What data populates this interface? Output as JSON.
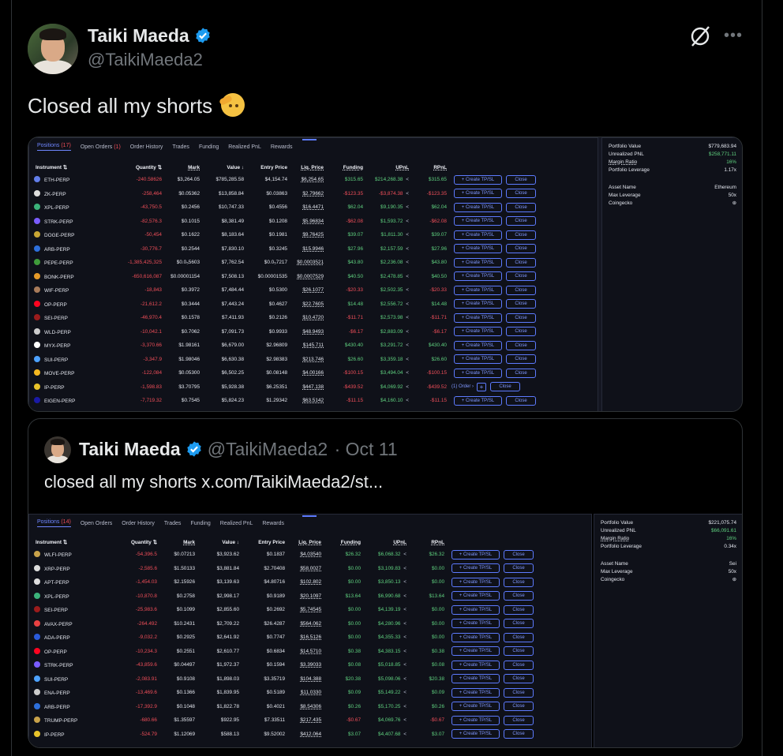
{
  "author": {
    "name": "Taiki Maeda",
    "handle": "@TaikiMaeda2"
  },
  "tweet": {
    "text": "Closed all my shorts"
  },
  "quoted": {
    "name": "Taiki Maeda",
    "handle": "@TaikiMaeda2",
    "date": "· Oct 11",
    "text": "closed all my shorts  x.com/TaikiMaeda2/st..."
  },
  "colors": {
    "accent": "#1d9bf0",
    "profit": "#5fd17f",
    "loss": "#ef4e59",
    "link": "#7f97ff"
  },
  "shot1": {
    "tabs": [
      {
        "label": "Positions",
        "badge": "(17)"
      },
      {
        "label": "Open Orders",
        "badge": "(1)"
      },
      {
        "label": "Order History",
        "badge": ""
      },
      {
        "label": "Trades",
        "badge": ""
      },
      {
        "label": "Funding",
        "badge": ""
      },
      {
        "label": "Realized PnL",
        "badge": ""
      },
      {
        "label": "Rewards",
        "badge": ""
      }
    ],
    "headers": [
      "Instrument",
      "Quantity",
      "Mark",
      "Value",
      "Entry Price",
      "Liq. Price",
      "Funding",
      "UPnL",
      "RPnL"
    ],
    "rows": [
      [
        "ETH-PERP",
        "-240.58626",
        "$3,264.05",
        "$785,285.58",
        "$4,154.74",
        "$6,254.65",
        "$315.65",
        "$214,268.38",
        "$315.65",
        "#627eea"
      ],
      [
        "ZK-PERP",
        "-258,464",
        "$0.05362",
        "$13,858.84",
        "$0.03863",
        "$2.79662",
        "-$123.35",
        "-$3,874.38",
        "-$123.35",
        "#dddddd"
      ],
      [
        "XPL-PERP",
        "-43,750.5",
        "$0.2456",
        "$10,747.33",
        "$0.4556",
        "$16.4471",
        "$62.04",
        "$9,190.35",
        "$62.04",
        "#3bb27a"
      ],
      [
        "STRK-PERP",
        "-82,576.3",
        "$0.1015",
        "$8,381.49",
        "$0.1208",
        "$5.96834",
        "-$62.08",
        "$1,593.72",
        "-$62.08",
        "#7a5cff"
      ],
      [
        "DOGE-PERP",
        "-50,454",
        "$0.1622",
        "$8,183.64",
        "$0.1981",
        "$9.76425",
        "$39.07",
        "$1,811.30",
        "$39.07",
        "#c8a634"
      ],
      [
        "ARB-PERP",
        "-30,776.7",
        "$0.2544",
        "$7,830.10",
        "$0.3245",
        "$15.9946",
        "$27.96",
        "$2,157.59",
        "$27.96",
        "#2d6fdb"
      ],
      [
        "PEPE-PERP",
        "-1,385,425,325",
        "$0.0₅5603",
        "$7,762.54",
        "$0.0₅7217",
        "$0.0003521",
        "$43.80",
        "$2,236.08",
        "$43.80",
        "#3f9b3a"
      ],
      [
        "BONK-PERP",
        "-650,616,087",
        "$0.00001154",
        "$7,508.13",
        "$0.00001535",
        "$0.0007529",
        "$40.50",
        "$2,478.85",
        "$40.50",
        "#e69a28"
      ],
      [
        "WIF-PERP",
        "-18,843",
        "$0.3972",
        "$7,484.44",
        "$0.5300",
        "$26.1077",
        "-$20.33",
        "$2,502.35",
        "-$20.33",
        "#a87b5a"
      ],
      [
        "OP-PERP",
        "-21,612.2",
        "$0.3444",
        "$7,443.24",
        "$0.4627",
        "$22.7605",
        "$14.48",
        "$2,556.72",
        "$14.48",
        "#ff0420"
      ],
      [
        "SEI-PERP",
        "-46,970.4",
        "$0.1578",
        "$7,411.93",
        "$0.2126",
        "$10.4720",
        "-$11.71",
        "$2,573.98",
        "-$11.71",
        "#9b1c1c"
      ],
      [
        "WLD-PERP",
        "-10,042.1",
        "$0.7062",
        "$7,091.73",
        "$0.9933",
        "$48.9493",
        "-$6.17",
        "$2,883.09",
        "-$6.17",
        "#cccccc"
      ],
      [
        "MYX-PERP",
        "-3,370.66",
        "$1.98161",
        "$6,679.00",
        "$2.96809",
        "$145.711",
        "$430.40",
        "$3,291.72",
        "$430.40",
        "#ffffff"
      ],
      [
        "SUI-PERP",
        "-3,347.9",
        "$1.98046",
        "$6,630.38",
        "$2.98383",
        "$213.746",
        "$26.60",
        "$3,359.18",
        "$26.60",
        "#4da2ff"
      ],
      [
        "MOVE-PERP",
        "-122,084",
        "$0.05300",
        "$6,502.25",
        "$0.08148",
        "$4.00166",
        "-$100.15",
        "$3,494.04",
        "-$100.15",
        "#f5b820"
      ],
      [
        "IP-PERP",
        "-1,598.83",
        "$3.70795",
        "$5,928.38",
        "$6.25351",
        "$447.138",
        "-$439.52",
        "$4,069.92",
        "-$439.52",
        "#e8c32a"
      ],
      [
        "EIGEN-PERP",
        "-7,719.32",
        "$0.7545",
        "$5,824.23",
        "$1.29342",
        "$63.5142",
        "-$11.15",
        "$4,160.10",
        "-$11.15",
        "#1a1aa6"
      ]
    ],
    "ip_orders": "(1) Order ›",
    "create_label": "+ Create TP/SL",
    "close_label": "Close",
    "summary": [
      [
        "Portfolio Value",
        "$779,683.94"
      ],
      [
        "Unrealized PNL",
        "$258,771.11"
      ],
      [
        "Margin Ratio",
        "16%"
      ],
      [
        "Portfolio Leverage",
        "1.17x"
      ]
    ],
    "asset": [
      [
        "Asset Name",
        "Ethereum"
      ],
      [
        "Max Leverage",
        "50x"
      ],
      [
        "Coingecko",
        "⊛"
      ]
    ]
  },
  "shot2": {
    "tabs": [
      {
        "label": "Positions",
        "badge": "(14)"
      },
      {
        "label": "Open Orders",
        "badge": ""
      },
      {
        "label": "Order History",
        "badge": ""
      },
      {
        "label": "Trades",
        "badge": ""
      },
      {
        "label": "Funding",
        "badge": ""
      },
      {
        "label": "Realized PnL",
        "badge": ""
      },
      {
        "label": "Rewards",
        "badge": ""
      }
    ],
    "headers": [
      "Instrument",
      "Quantity",
      "Mark",
      "Value",
      "Entry Price",
      "Liq. Price",
      "Funding",
      "UPnL",
      "RPnL"
    ],
    "rows": [
      [
        "WLFI-PERP",
        "-54,396.5",
        "$0.07213",
        "$3,923.62",
        "$0.1837",
        "$4.03540",
        "$26.32",
        "$6,068.32",
        "$26.32",
        "#c8a24a"
      ],
      [
        "XRP-PERP",
        "-2,585.6",
        "$1.50133",
        "$3,881.84",
        "$2.70408",
        "$58.0027",
        "$0.00",
        "$3,109.83",
        "$0.00",
        "#dddddd"
      ],
      [
        "APT-PERP",
        "-1,454.03",
        "$2.15926",
        "$3,139.63",
        "$4.80716",
        "$102.802",
        "$0.00",
        "$3,850.13",
        "$0.00",
        "#dddddd"
      ],
      [
        "XPL-PERP",
        "-10,870.8",
        "$0.2758",
        "$2,998.17",
        "$0.9189",
        "$20.1097",
        "$13.64",
        "$6,990.68",
        "$13.64",
        "#3bb27a"
      ],
      [
        "SEI-PERP",
        "-25,983.6",
        "$0.1099",
        "$2,855.60",
        "$0.2692",
        "$5.74545",
        "$0.00",
        "$4,139.19",
        "$0.00",
        "#9b1c1c"
      ],
      [
        "AVAX-PERP",
        "-264.492",
        "$10.2431",
        "$2,709.22",
        "$26.4287",
        "$564.062",
        "$0.00",
        "$4,280.96",
        "$0.00",
        "#e84142"
      ],
      [
        "ADA-PERP",
        "-9,032.2",
        "$0.2925",
        "$2,641.92",
        "$0.7747",
        "$16.5126",
        "$0.00",
        "$4,355.33",
        "$0.00",
        "#2a5ada"
      ],
      [
        "OP-PERP",
        "-10,234.3",
        "$0.2551",
        "$2,610.77",
        "$0.6834",
        "$14.5710",
        "$0.38",
        "$4,383.15",
        "$0.38",
        "#ff0420"
      ],
      [
        "STRK-PERP",
        "-43,859.6",
        "$0.04497",
        "$1,972.37",
        "$0.1594",
        "$3.39033",
        "$0.08",
        "$5,018.85",
        "$0.08",
        "#7a5cff"
      ],
      [
        "SUI-PERP",
        "-2,083.91",
        "$0.9108",
        "$1,898.03",
        "$3.35719",
        "$104.388",
        "$20.38",
        "$5,098.06",
        "$20.38",
        "#4da2ff"
      ],
      [
        "ENA-PERP",
        "-13,469.6",
        "$0.1366",
        "$1,839.95",
        "$0.5189",
        "$11.0330",
        "$0.09",
        "$5,149.22",
        "$0.09",
        "#cccccc"
      ],
      [
        "ARB-PERP",
        "-17,392.9",
        "$0.1048",
        "$1,822.78",
        "$0.4021",
        "$8.54306",
        "$0.26",
        "$5,170.25",
        "$0.26",
        "#2d6fdb"
      ],
      [
        "TRUMP-PERP",
        "-680.66",
        "$1.35597",
        "$922.95",
        "$7.33511",
        "$217.435",
        "-$0.67",
        "$4,069.76",
        "-$0.67",
        "#c8a24a"
      ],
      [
        "IP-PERP",
        "-524.79",
        "$1.12069",
        "$588.13",
        "$9.52002",
        "$412.064",
        "$3.07",
        "$4,407.68",
        "$3.07",
        "#e8c32a"
      ]
    ],
    "create_label": "+ Create TP/SL",
    "close_label": "Close",
    "summary": [
      [
        "Portfolio Value",
        "$221,075.74"
      ],
      [
        "Unrealized PNL",
        "$66,091.61"
      ],
      [
        "Margin Ratio",
        "16%"
      ],
      [
        "Portfolio Leverage",
        "0.34x"
      ]
    ],
    "asset": [
      [
        "Asset Name",
        "Sei"
      ],
      [
        "Max Leverage",
        "50x"
      ],
      [
        "Coingecko",
        "⊛"
      ]
    ]
  }
}
